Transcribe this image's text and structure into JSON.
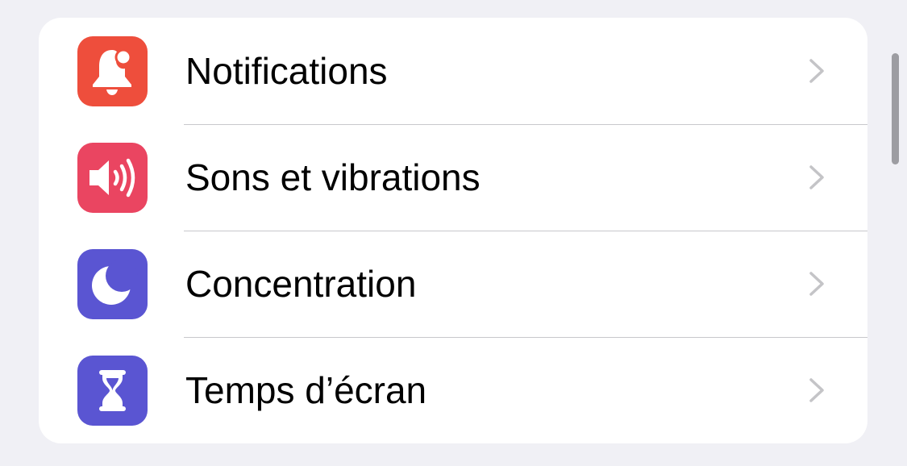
{
  "settings_group": {
    "items": [
      {
        "label": "Notifications",
        "icon": "notifications-bell-icon",
        "color": "#ee4e3c"
      },
      {
        "label": "Sons et vibrations",
        "icon": "speaker-volume-icon",
        "color": "#ea4561"
      },
      {
        "label": "Concentration",
        "icon": "moon-icon",
        "color": "#5a55d2"
      },
      {
        "label": "Temps d’écran",
        "icon": "hourglass-icon",
        "color": "#5a55d2"
      }
    ],
    "chevron_icon": "chevron-right-icon"
  },
  "colors": {
    "background": "#f0f0f5",
    "card": "#ffffff",
    "separator": "#c8c8cc",
    "chevron": "#c4c4c7",
    "text": "#000000"
  }
}
